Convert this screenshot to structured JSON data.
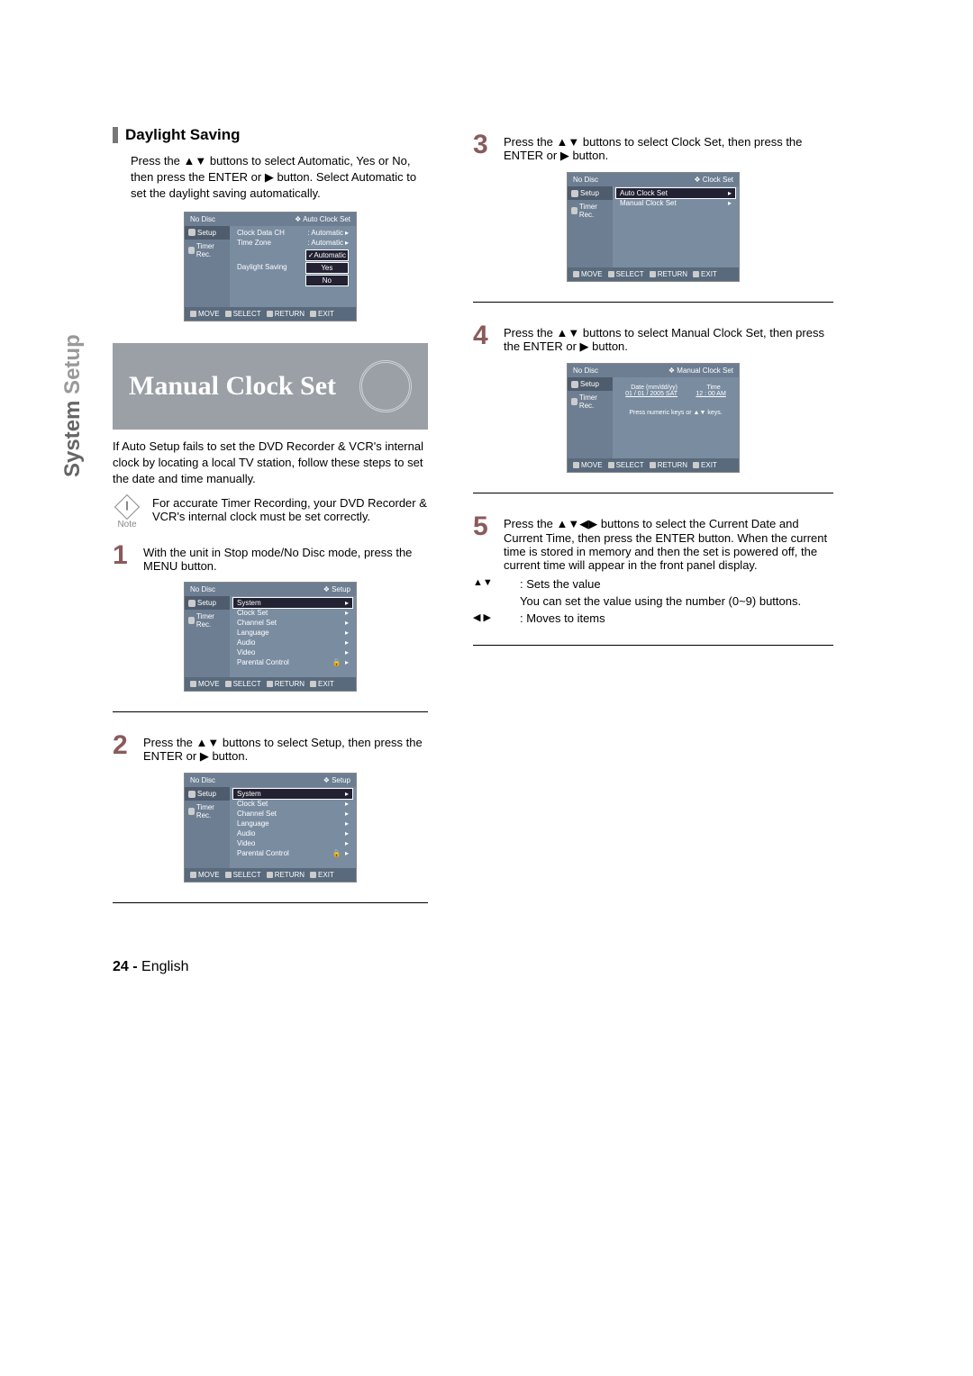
{
  "side_label": {
    "part1": "System ",
    "part2": "Setup"
  },
  "daylight": {
    "heading": "Daylight Saving",
    "para": "Press the ▲▼ buttons to select Automatic, Yes or No, then press the ENTER or ▶ button. Select Automatic to set the daylight saving automatically."
  },
  "banner": {
    "title": "Manual Clock Set"
  },
  "intro": "If Auto Setup fails to set the DVD Recorder & VCR's internal clock by locating a local TV station, follow these steps to set the date and time manually.",
  "note": {
    "label": "Note",
    "text": "For accurate Timer Recording, your DVD Recorder & VCR's internal clock must be set correctly."
  },
  "step1": {
    "num": "1",
    "text": "With the unit in Stop mode/No Disc mode, press the MENU button."
  },
  "step2": {
    "num": "2",
    "text": "Press the ▲▼ buttons to select Setup, then press the ENTER or ▶ button."
  },
  "step3": {
    "num": "3",
    "text": "Press the ▲▼ buttons to select Clock Set, then press the ENTER or ▶ button."
  },
  "step4": {
    "num": "4",
    "text": "Press the ▲▼ buttons to select Manual Clock Set, then press the ENTER or ▶ button."
  },
  "step5": {
    "num": "5",
    "text": "Press the ▲▼◀▶ buttons to select the Current Date and Current Time, then press the ENTER button. When the current time is stored in memory and then the set is powered off, the current time will appear in the front panel display."
  },
  "sub1": {
    "sym": "▲▼",
    "label": ": Sets the value",
    "text": "You can set the value using the number (0~9) buttons."
  },
  "sub2": {
    "sym": "◀ ▶",
    "label": ": Moves to items"
  },
  "footer": {
    "num": "24 -",
    "lang": " English"
  },
  "osd": {
    "no_disc": "No Disc",
    "setup_label": "Setup",
    "timer_rec": "Timer Rec.",
    "move": "MOVE",
    "select": "SELECT",
    "return": "RETURN",
    "exit": "EXIT",
    "auto_clock_set": "Auto Clock Set",
    "clock_data_ch": "Clock Data CH",
    "time_zone": "Time Zone",
    "daylight_saving": "Daylight Saving",
    "automatic": "Automatic",
    "yes": "Yes",
    "no": "No",
    "setup_breadcrumb": "Setup",
    "system": "System",
    "clock_set": "Clock Set",
    "channel_set": "Channel Set",
    "language": "Language",
    "audio": "Audio",
    "video": "Video",
    "parental": "Parental Control",
    "manual_clock_set": "Manual Clock Set",
    "date_label": "Date (mm/dd/yy)",
    "time_label": "Time",
    "date_val": "01 / 01 / 2005  SAT",
    "time_val": "12 : 00  AM",
    "hint": "Press numeric keys or ▲▼ keys."
  }
}
